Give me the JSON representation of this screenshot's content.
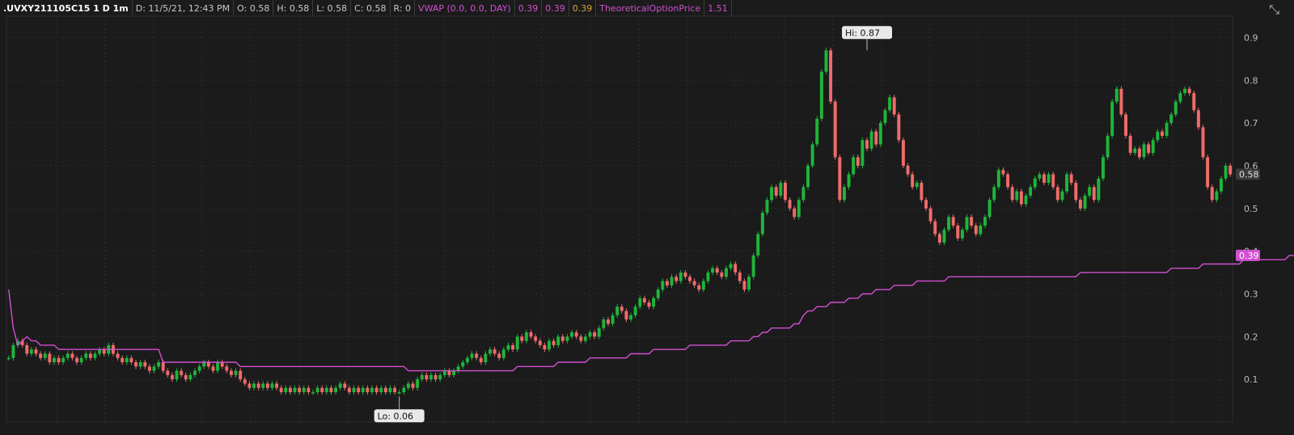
{
  "header": {
    "symbol": ".UVXY211105C15 1 D 1m",
    "date": "D: 11/5/21, 12:43 PM",
    "open": "O: 0.58",
    "high": "H: 0.58",
    "low": "L: 0.58",
    "close": "C: 0.58",
    "range": "R: 0",
    "vwap_label": "VWAP (0.0, 0.0, DAY)",
    "vwap_values": [
      "0.39",
      "0.39",
      "0.39"
    ],
    "top_label": "TheoreticalOptionPrice",
    "top_value": "1.51",
    "expand_icon": "expand-icon"
  },
  "colors": {
    "background": "#1b1b1b",
    "up": "#1fb53a",
    "down": "#f06b6b",
    "vwap": "#d24fd2",
    "grid": "#3c3c3c",
    "axis_text": "#bdbdbd"
  },
  "chart_data": {
    "type": "candlestick",
    "y_axis": {
      "min": 0.0,
      "max": 0.95,
      "ticks": [
        0.1,
        0.2,
        0.3,
        0.4,
        0.5,
        0.6,
        0.7,
        0.8,
        0.9
      ],
      "tick_labels": [
        "0.1",
        "0.2",
        "0.3",
        "0.4",
        "0.5",
        "0.6",
        "0.7",
        "0.8",
        "0.9"
      ],
      "side": "right"
    },
    "grid": true,
    "last_price_label": "0.58",
    "vwap_last_label": "0.39",
    "annotations": [
      {
        "label": "Hi: 0.87",
        "value": 0.87,
        "index": 189
      },
      {
        "label": "Lo: 0.06",
        "value": 0.06,
        "index": 86
      }
    ],
    "close": [
      0.15,
      0.18,
      0.19,
      0.18,
      0.16,
      0.17,
      0.16,
      0.15,
      0.16,
      0.14,
      0.15,
      0.14,
      0.15,
      0.16,
      0.15,
      0.14,
      0.15,
      0.16,
      0.15,
      0.16,
      0.17,
      0.16,
      0.18,
      0.16,
      0.15,
      0.14,
      0.15,
      0.14,
      0.13,
      0.14,
      0.13,
      0.12,
      0.13,
      0.14,
      0.12,
      0.11,
      0.1,
      0.12,
      0.11,
      0.1,
      0.11,
      0.12,
      0.13,
      0.14,
      0.13,
      0.12,
      0.14,
      0.13,
      0.12,
      0.11,
      0.12,
      0.1,
      0.09,
      0.08,
      0.09,
      0.08,
      0.09,
      0.08,
      0.09,
      0.08,
      0.07,
      0.08,
      0.07,
      0.08,
      0.07,
      0.08,
      0.07,
      0.07,
      0.08,
      0.07,
      0.08,
      0.07,
      0.08,
      0.09,
      0.08,
      0.07,
      0.08,
      0.07,
      0.08,
      0.07,
      0.08,
      0.07,
      0.08,
      0.07,
      0.08,
      0.07,
      0.07,
      0.08,
      0.09,
      0.08,
      0.1,
      0.11,
      0.1,
      0.11,
      0.1,
      0.11,
      0.12,
      0.11,
      0.12,
      0.13,
      0.14,
      0.15,
      0.16,
      0.15,
      0.14,
      0.16,
      0.17,
      0.16,
      0.15,
      0.17,
      0.18,
      0.17,
      0.2,
      0.19,
      0.21,
      0.2,
      0.19,
      0.18,
      0.17,
      0.19,
      0.18,
      0.2,
      0.19,
      0.2,
      0.21,
      0.2,
      0.19,
      0.2,
      0.21,
      0.2,
      0.22,
      0.24,
      0.23,
      0.25,
      0.27,
      0.26,
      0.24,
      0.25,
      0.27,
      0.29,
      0.28,
      0.27,
      0.29,
      0.31,
      0.33,
      0.32,
      0.34,
      0.33,
      0.35,
      0.34,
      0.33,
      0.32,
      0.31,
      0.33,
      0.35,
      0.36,
      0.35,
      0.34,
      0.36,
      0.37,
      0.35,
      0.33,
      0.31,
      0.34,
      0.39,
      0.44,
      0.49,
      0.52,
      0.55,
      0.53,
      0.56,
      0.52,
      0.5,
      0.48,
      0.52,
      0.55,
      0.6,
      0.65,
      0.71,
      0.82,
      0.87,
      0.75,
      0.62,
      0.52,
      0.55,
      0.58,
      0.62,
      0.6,
      0.66,
      0.64,
      0.68,
      0.65,
      0.7,
      0.73,
      0.76,
      0.72,
      0.66,
      0.6,
      0.58,
      0.55,
      0.56,
      0.52,
      0.5,
      0.47,
      0.44,
      0.42,
      0.45,
      0.48,
      0.46,
      0.43,
      0.45,
      0.48,
      0.46,
      0.44,
      0.46,
      0.48,
      0.52,
      0.55,
      0.59,
      0.58,
      0.55,
      0.52,
      0.54,
      0.51,
      0.53,
      0.55,
      0.57,
      0.58,
      0.56,
      0.58,
      0.55,
      0.52,
      0.54,
      0.58,
      0.56,
      0.52,
      0.5,
      0.53,
      0.55,
      0.52,
      0.57,
      0.62,
      0.67,
      0.75,
      0.78,
      0.72,
      0.67,
      0.63,
      0.64,
      0.62,
      0.65,
      0.63,
      0.66,
      0.68,
      0.67,
      0.7,
      0.72,
      0.75,
      0.77,
      0.78,
      0.77,
      0.73,
      0.69,
      0.62,
      0.55,
      0.52,
      0.54,
      0.57,
      0.6,
      0.58
    ],
    "vwap": [
      0.31,
      0.22,
      0.18,
      0.19,
      0.2,
      0.19,
      0.19,
      0.18,
      0.18,
      0.18,
      0.18,
      0.17,
      0.17,
      0.17,
      0.17,
      0.17,
      0.17,
      0.17,
      0.17,
      0.17,
      0.17,
      0.17,
      0.17,
      0.17,
      0.17,
      0.17,
      0.17,
      0.17,
      0.17,
      0.17,
      0.17,
      0.17,
      0.17,
      0.17,
      0.14,
      0.14,
      0.14,
      0.14,
      0.14,
      0.14,
      0.14,
      0.14,
      0.14,
      0.14,
      0.14,
      0.14,
      0.14,
      0.14,
      0.14,
      0.14,
      0.14,
      0.13,
      0.13,
      0.13,
      0.13,
      0.13,
      0.13,
      0.13,
      0.13,
      0.13,
      0.13,
      0.13,
      0.13,
      0.13,
      0.13,
      0.13,
      0.13,
      0.13,
      0.13,
      0.13,
      0.13,
      0.13,
      0.13,
      0.13,
      0.13,
      0.13,
      0.13,
      0.13,
      0.13,
      0.13,
      0.13,
      0.13,
      0.13,
      0.13,
      0.13,
      0.13,
      0.13,
      0.13,
      0.12,
      0.12,
      0.12,
      0.12,
      0.12,
      0.12,
      0.12,
      0.12,
      0.12,
      0.12,
      0.12,
      0.12,
      0.12,
      0.12,
      0.12,
      0.12,
      0.12,
      0.12,
      0.12,
      0.12,
      0.12,
      0.12,
      0.12,
      0.12,
      0.13,
      0.13,
      0.13,
      0.13,
      0.13,
      0.13,
      0.13,
      0.13,
      0.13,
      0.14,
      0.14,
      0.14,
      0.14,
      0.14,
      0.14,
      0.14,
      0.15,
      0.15,
      0.15,
      0.15,
      0.15,
      0.15,
      0.15,
      0.15,
      0.15,
      0.16,
      0.16,
      0.16,
      0.16,
      0.16,
      0.17,
      0.17,
      0.17,
      0.17,
      0.17,
      0.17,
      0.17,
      0.17,
      0.18,
      0.18,
      0.18,
      0.18,
      0.18,
      0.18,
      0.18,
      0.18,
      0.18,
      0.19,
      0.19,
      0.19,
      0.19,
      0.19,
      0.2,
      0.2,
      0.21,
      0.21,
      0.22,
      0.22,
      0.22,
      0.22,
      0.22,
      0.23,
      0.23,
      0.25,
      0.26,
      0.26,
      0.27,
      0.27,
      0.27,
      0.28,
      0.28,
      0.28,
      0.28,
      0.29,
      0.29,
      0.29,
      0.3,
      0.3,
      0.3,
      0.31,
      0.31,
      0.31,
      0.31,
      0.32,
      0.32,
      0.32,
      0.32,
      0.32,
      0.33,
      0.33,
      0.33,
      0.33,
      0.33,
      0.33,
      0.33,
      0.34,
      0.34,
      0.34,
      0.34,
      0.34,
      0.34,
      0.34,
      0.34,
      0.34,
      0.34,
      0.34,
      0.34,
      0.34,
      0.34,
      0.34,
      0.34,
      0.34,
      0.34,
      0.34,
      0.34,
      0.34,
      0.34,
      0.34,
      0.34,
      0.34,
      0.34,
      0.34,
      0.34,
      0.34,
      0.35,
      0.35,
      0.35,
      0.35,
      0.35,
      0.35,
      0.35,
      0.35,
      0.35,
      0.35,
      0.35,
      0.35,
      0.35,
      0.35,
      0.35,
      0.35,
      0.35,
      0.35,
      0.35,
      0.35,
      0.36,
      0.36,
      0.36,
      0.36,
      0.36,
      0.36,
      0.36,
      0.37,
      0.37,
      0.37,
      0.37,
      0.37,
      0.37,
      0.37,
      0.37,
      0.37,
      0.38,
      0.38,
      0.38,
      0.38,
      0.38,
      0.38,
      0.38,
      0.38,
      0.38,
      0.38,
      0.39,
      0.39,
      0.39,
      0.39,
      0.39,
      0.39
    ]
  }
}
